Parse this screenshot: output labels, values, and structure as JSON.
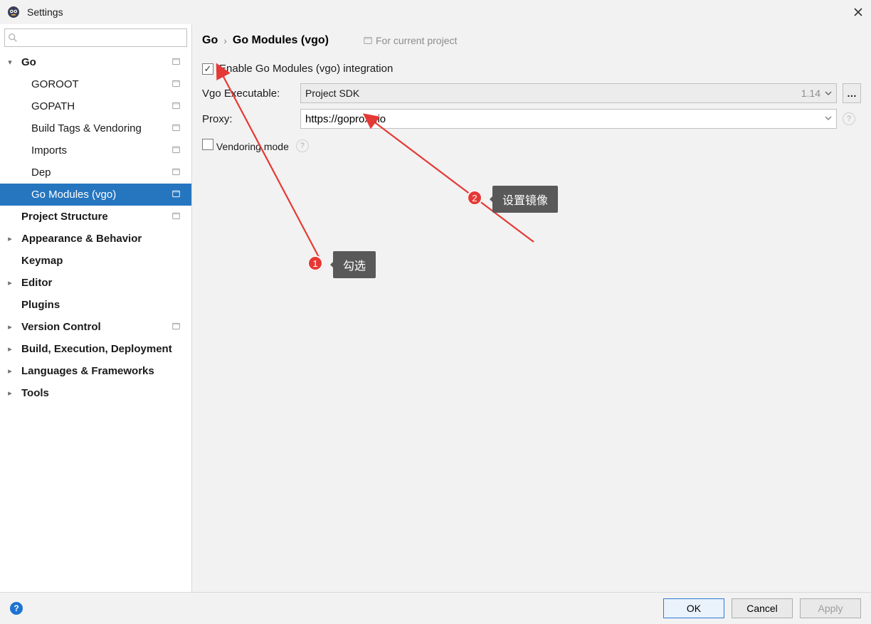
{
  "window": {
    "title": "Settings"
  },
  "search": {
    "placeholder": ""
  },
  "tree": {
    "items": [
      {
        "label": "Go",
        "depth": 0,
        "bold": true,
        "expanded": true,
        "hasChevron": true,
        "tag": true
      },
      {
        "label": "GOROOT",
        "depth": 1,
        "tag": true
      },
      {
        "label": "GOPATH",
        "depth": 1,
        "tag": true
      },
      {
        "label": "Build Tags & Vendoring",
        "depth": 1,
        "tag": true
      },
      {
        "label": "Imports",
        "depth": 1,
        "tag": true
      },
      {
        "label": "Dep",
        "depth": 1,
        "tag": true
      },
      {
        "label": "Go Modules (vgo)",
        "depth": 1,
        "selected": true,
        "tag": true
      },
      {
        "label": "Project Structure",
        "depth": 0,
        "bold": true,
        "tag": true
      },
      {
        "label": "Appearance & Behavior",
        "depth": 0,
        "bold": true,
        "hasChevron": true
      },
      {
        "label": "Keymap",
        "depth": 0,
        "bold": true
      },
      {
        "label": "Editor",
        "depth": 0,
        "bold": true,
        "hasChevron": true
      },
      {
        "label": "Plugins",
        "depth": 0,
        "bold": true
      },
      {
        "label": "Version Control",
        "depth": 0,
        "bold": true,
        "hasChevron": true,
        "tag": true
      },
      {
        "label": "Build, Execution, Deployment",
        "depth": 0,
        "bold": true,
        "hasChevron": true
      },
      {
        "label": "Languages & Frameworks",
        "depth": 0,
        "bold": true,
        "hasChevron": true
      },
      {
        "label": "Tools",
        "depth": 0,
        "bold": true,
        "hasChevron": true
      }
    ]
  },
  "breadcrumb": {
    "parent": "Go",
    "current": "Go Modules (vgo)",
    "scope": "For current project"
  },
  "form": {
    "enable_label": "Enable Go Modules (vgo) integration",
    "enable_checked": true,
    "vgo_exec_label": "Vgo Executable:",
    "vgo_exec_value": "Project SDK",
    "vgo_exec_version": "1.14",
    "proxy_label": "Proxy:",
    "proxy_value": "https://goproxy.io",
    "vendoring_label": "Vendoring mode",
    "vendoring_checked": false
  },
  "buttons": {
    "ok": "OK",
    "cancel": "Cancel",
    "apply": "Apply"
  },
  "annotations": {
    "callout1": {
      "num": "1",
      "text": "勾选"
    },
    "callout2": {
      "num": "2",
      "text": "设置镜像"
    }
  }
}
